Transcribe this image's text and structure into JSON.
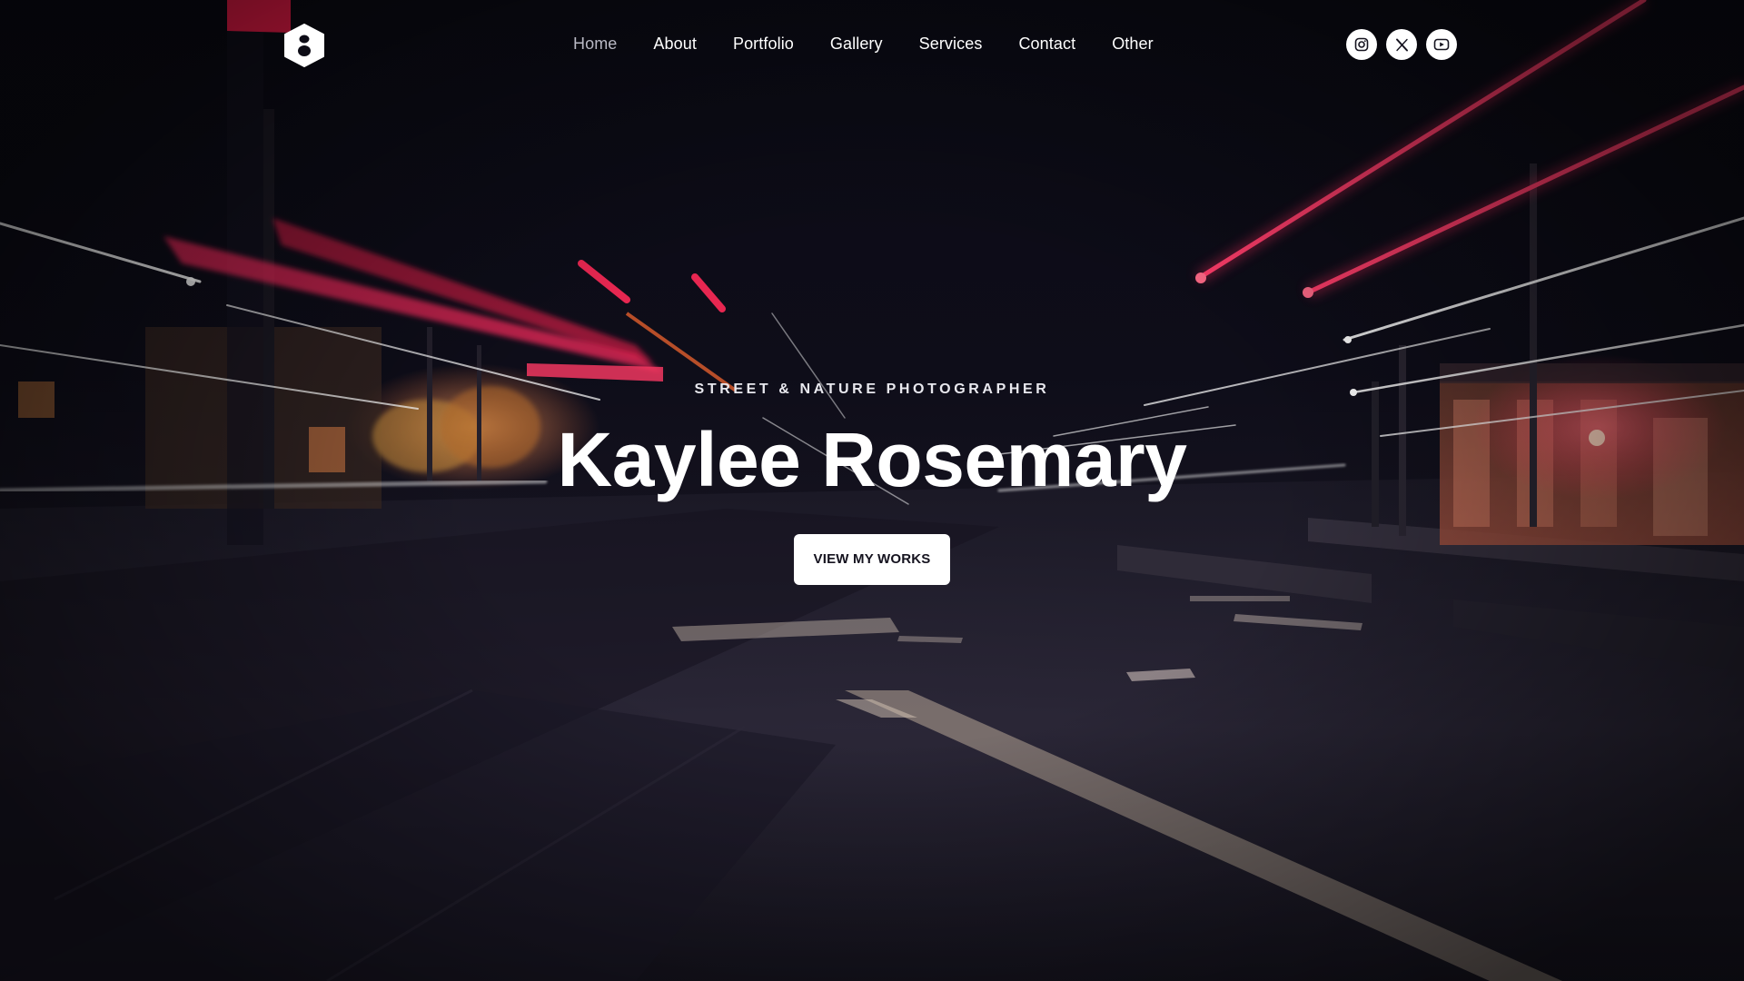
{
  "header": {
    "logo_alt": "Logo",
    "nav": [
      {
        "label": "Home",
        "active": true
      },
      {
        "label": "About"
      },
      {
        "label": "Portfolio"
      },
      {
        "label": "Gallery"
      },
      {
        "label": "Services"
      },
      {
        "label": "Contact"
      },
      {
        "label": "Other"
      }
    ],
    "social": [
      {
        "icon": "instagram-icon"
      },
      {
        "icon": "x-twitter-icon"
      },
      {
        "icon": "youtube-icon"
      }
    ]
  },
  "hero": {
    "eyebrow": "STREET & NATURE PHOTOGRAPHER",
    "title": "Kaylee Rosemary",
    "cta_label": "VIEW MY WORKS"
  },
  "colors": {
    "background": "#0d0c16",
    "accent_red": "#ff2b5e",
    "warm_light": "#ffb070",
    "text": "#ffffff",
    "nav_active": "#b9b9c4"
  }
}
